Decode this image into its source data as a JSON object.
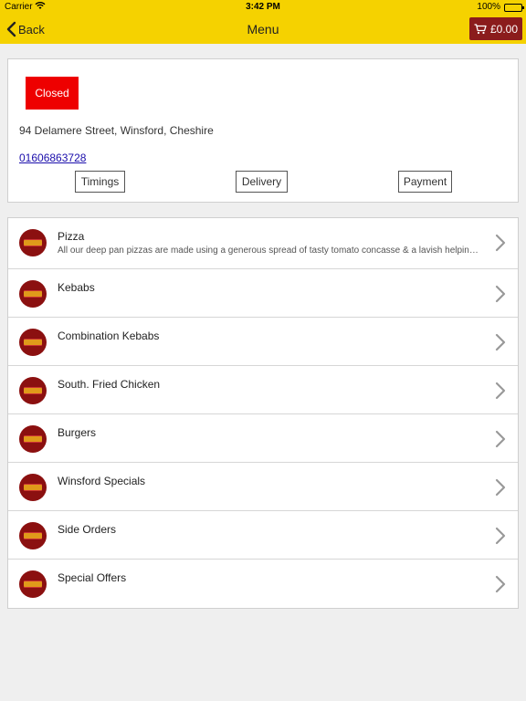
{
  "status_bar": {
    "carrier": "Carrier",
    "time": "3:42 PM",
    "battery": "100%"
  },
  "nav": {
    "back_label": "Back",
    "title": "Menu",
    "cart_amount": "£0.00"
  },
  "store": {
    "status": "Closed",
    "address": "94 Delamere Street, Winsford, Cheshire",
    "phone": "01606863728",
    "buttons": {
      "timings": "Timings",
      "delivery": "Delivery",
      "payment": "Payment"
    }
  },
  "menu": {
    "items": [
      {
        "title": "Pizza",
        "description": "All our deep pan pizzas are made using a generous spread of tasty tomato concasse & a lavish helping of mozzarella cheese"
      },
      {
        "title": "Kebabs"
      },
      {
        "title": "Combination Kebabs"
      },
      {
        "title": "South. Fried Chicken"
      },
      {
        "title": "Burgers"
      },
      {
        "title": "Winsford Specials"
      },
      {
        "title": "Side Orders"
      },
      {
        "title": "Special Offers"
      }
    ]
  },
  "colors": {
    "brand_yellow": "#f5d200",
    "cart_maroon": "#8b1c1c",
    "closed_red": "#ee0000",
    "link_blue": "#1a0dab"
  },
  "icons": {
    "back": "chevron-left-icon",
    "cart": "cart-icon",
    "row": "chevron-right-icon",
    "logo": "restaurant-logo"
  }
}
